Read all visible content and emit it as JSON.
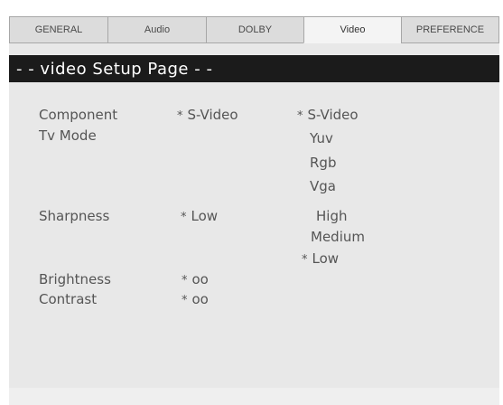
{
  "tabs": [
    "GENERAL",
    "Audio",
    "DOLBY",
    "Video",
    "PREFERENCE"
  ],
  "active_tab": "Video",
  "page_title": "- -  video Setup Page  - -",
  "settings": {
    "component_label": "Component",
    "tv_mode_label": "Tv Mode",
    "tv_mode_value": "S-Video",
    "tv_mode_options": [
      "S-Video",
      "Yuv",
      "Rgb",
      "Vga"
    ],
    "sharpness_label": "Sharpness",
    "sharpness_value": "Low",
    "sharpness_options": [
      "High",
      "Medium",
      "Low"
    ],
    "brightness_label": "Brightness",
    "brightness_value": "oo",
    "contrast_label": "Contrast",
    "contrast_value": "oo"
  },
  "marker": "*",
  "colors": {
    "title_bar": "#1b1b1b",
    "panel_bg": "#e8e8e8",
    "text": "#555555"
  }
}
